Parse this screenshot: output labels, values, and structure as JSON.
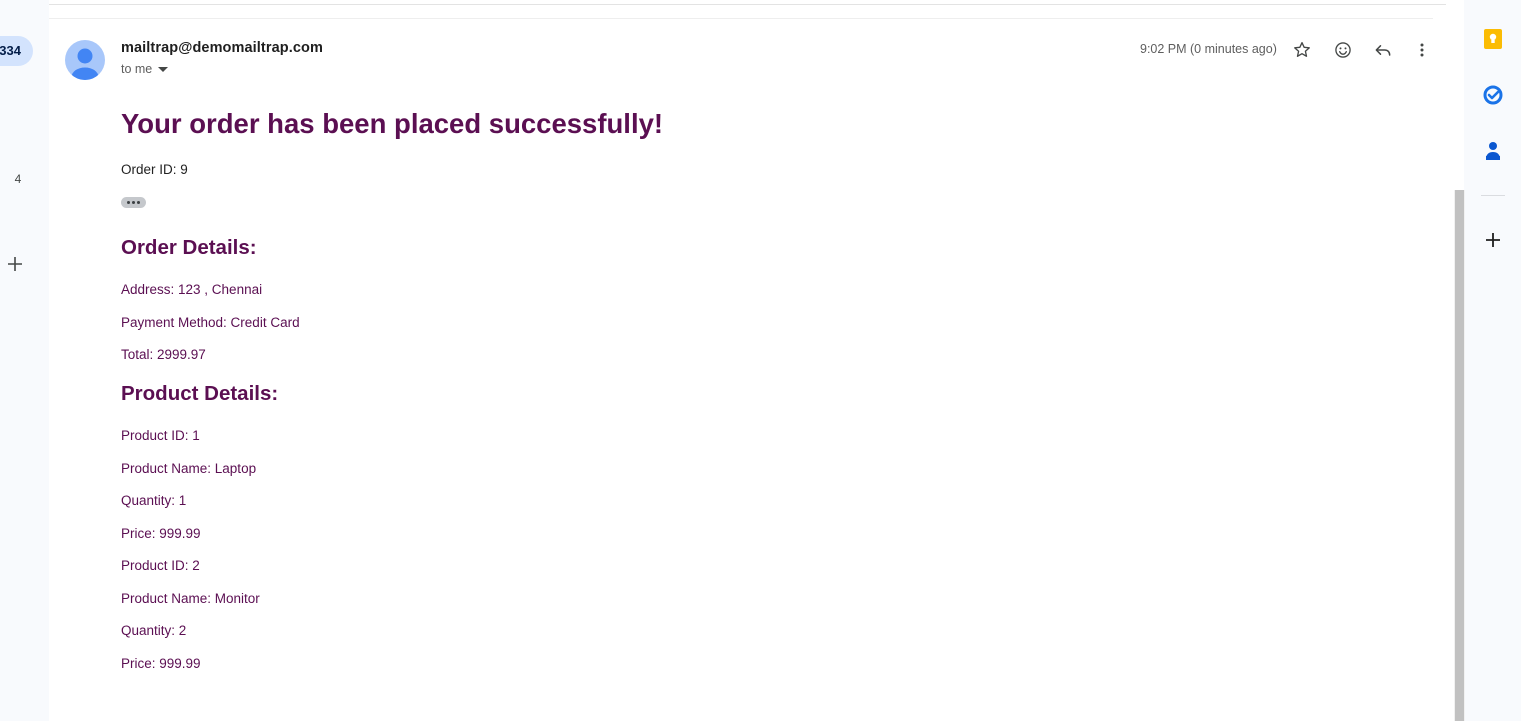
{
  "left_rail": {
    "unread_count": "334",
    "count_label": "4"
  },
  "header": {
    "sender": "mailtrap@demomailtrap.com",
    "to_label": "to me",
    "time": "9:02 PM (0 minutes ago)"
  },
  "email": {
    "title": "Your order has been placed successfully!",
    "order_id_line": "Order ID: 9",
    "order_details_heading": "Order Details:",
    "address_line": "Address: 123 , Chennai",
    "payment_line": "Payment Method: Credit Card",
    "total_line": "Total: 2999.97",
    "product_details_heading": "Product Details:",
    "products": [
      {
        "id_line": "Product ID: 1",
        "name_line": "Product Name: Laptop",
        "quantity_line": "Quantity: 1",
        "price_line": "Price: 999.99"
      },
      {
        "id_line": "Product ID: 2",
        "name_line": "Product Name: Monitor",
        "quantity_line": "Quantity: 2",
        "price_line": "Price: 999.99"
      }
    ]
  },
  "icons": {
    "star": "star-icon",
    "emoji": "emoji-icon",
    "reply": "reply-icon",
    "more": "more-vert-icon",
    "keep": "keep-icon",
    "tasks": "tasks-icon",
    "contacts": "contacts-icon",
    "add": "add-icon"
  },
  "colors": {
    "heading": "#5b0f52",
    "keep_yellow": "#fbbc04",
    "tasks_blue": "#1a73e8",
    "contacts_blue": "#0b57d0",
    "avatar_bg": "#a8c7fa",
    "avatar_fg": "#4285f4"
  }
}
